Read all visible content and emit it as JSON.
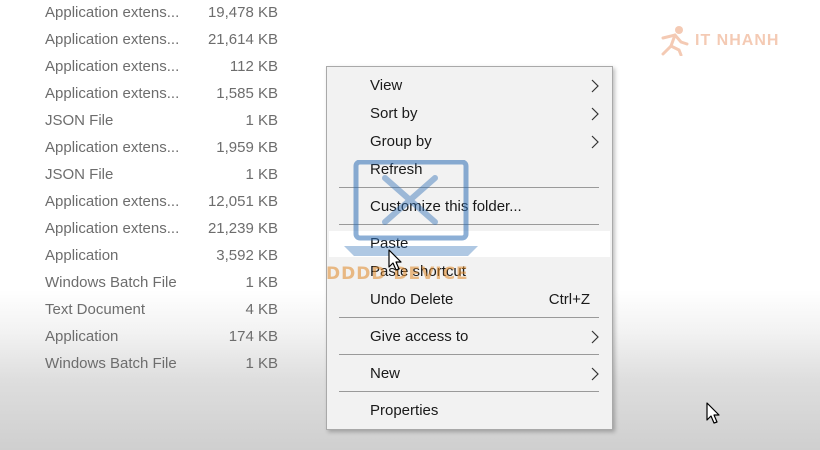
{
  "files": [
    {
      "type": "Application extens...",
      "size": "19,478 KB"
    },
    {
      "type": "Application extens...",
      "size": "21,614 KB"
    },
    {
      "type": "Application extens...",
      "size": "112 KB"
    },
    {
      "type": "Application extens...",
      "size": "1,585 KB"
    },
    {
      "type": "JSON File",
      "size": "1 KB"
    },
    {
      "type": "Application extens...",
      "size": "1,959 KB"
    },
    {
      "type": "JSON File",
      "size": "1 KB"
    },
    {
      "type": "Application extens...",
      "size": "12,051 KB"
    },
    {
      "type": "Application extens...",
      "size": "21,239 KB"
    },
    {
      "type": "Application",
      "size": "3,592 KB"
    },
    {
      "type": "Windows Batch File",
      "size": "1 KB"
    },
    {
      "type": "Text Document",
      "size": "4 KB"
    },
    {
      "type": "Application",
      "size": "174 KB"
    },
    {
      "type": "Windows Batch File",
      "size": "1 KB"
    }
  ],
  "context_menu": {
    "view": "View",
    "sort_by": "Sort by",
    "group_by": "Group by",
    "refresh": "Refresh",
    "customize": "Customize this folder...",
    "paste": "Paste",
    "paste_shortcut": "Paste shortcut",
    "undo_delete": "Undo Delete",
    "undo_delete_shortcut": "Ctrl+Z",
    "give_access": "Give access to",
    "new": "New",
    "properties": "Properties",
    "highlighted_item": "Paste"
  },
  "watermarks": {
    "itnhanh": "IT NHANH",
    "dd": "DDDD DEVICE"
  },
  "colors": {
    "menu_background": "#f2f2f2",
    "menu_highlight": "#ffffff",
    "file_text": "#6d6d6d",
    "watermark_orange": "#e06a2a",
    "watermark_blue": "#2f6fb5"
  },
  "icons": {
    "submenu": "chevron-right-icon",
    "cursor": "mouse-pointer-icon"
  }
}
